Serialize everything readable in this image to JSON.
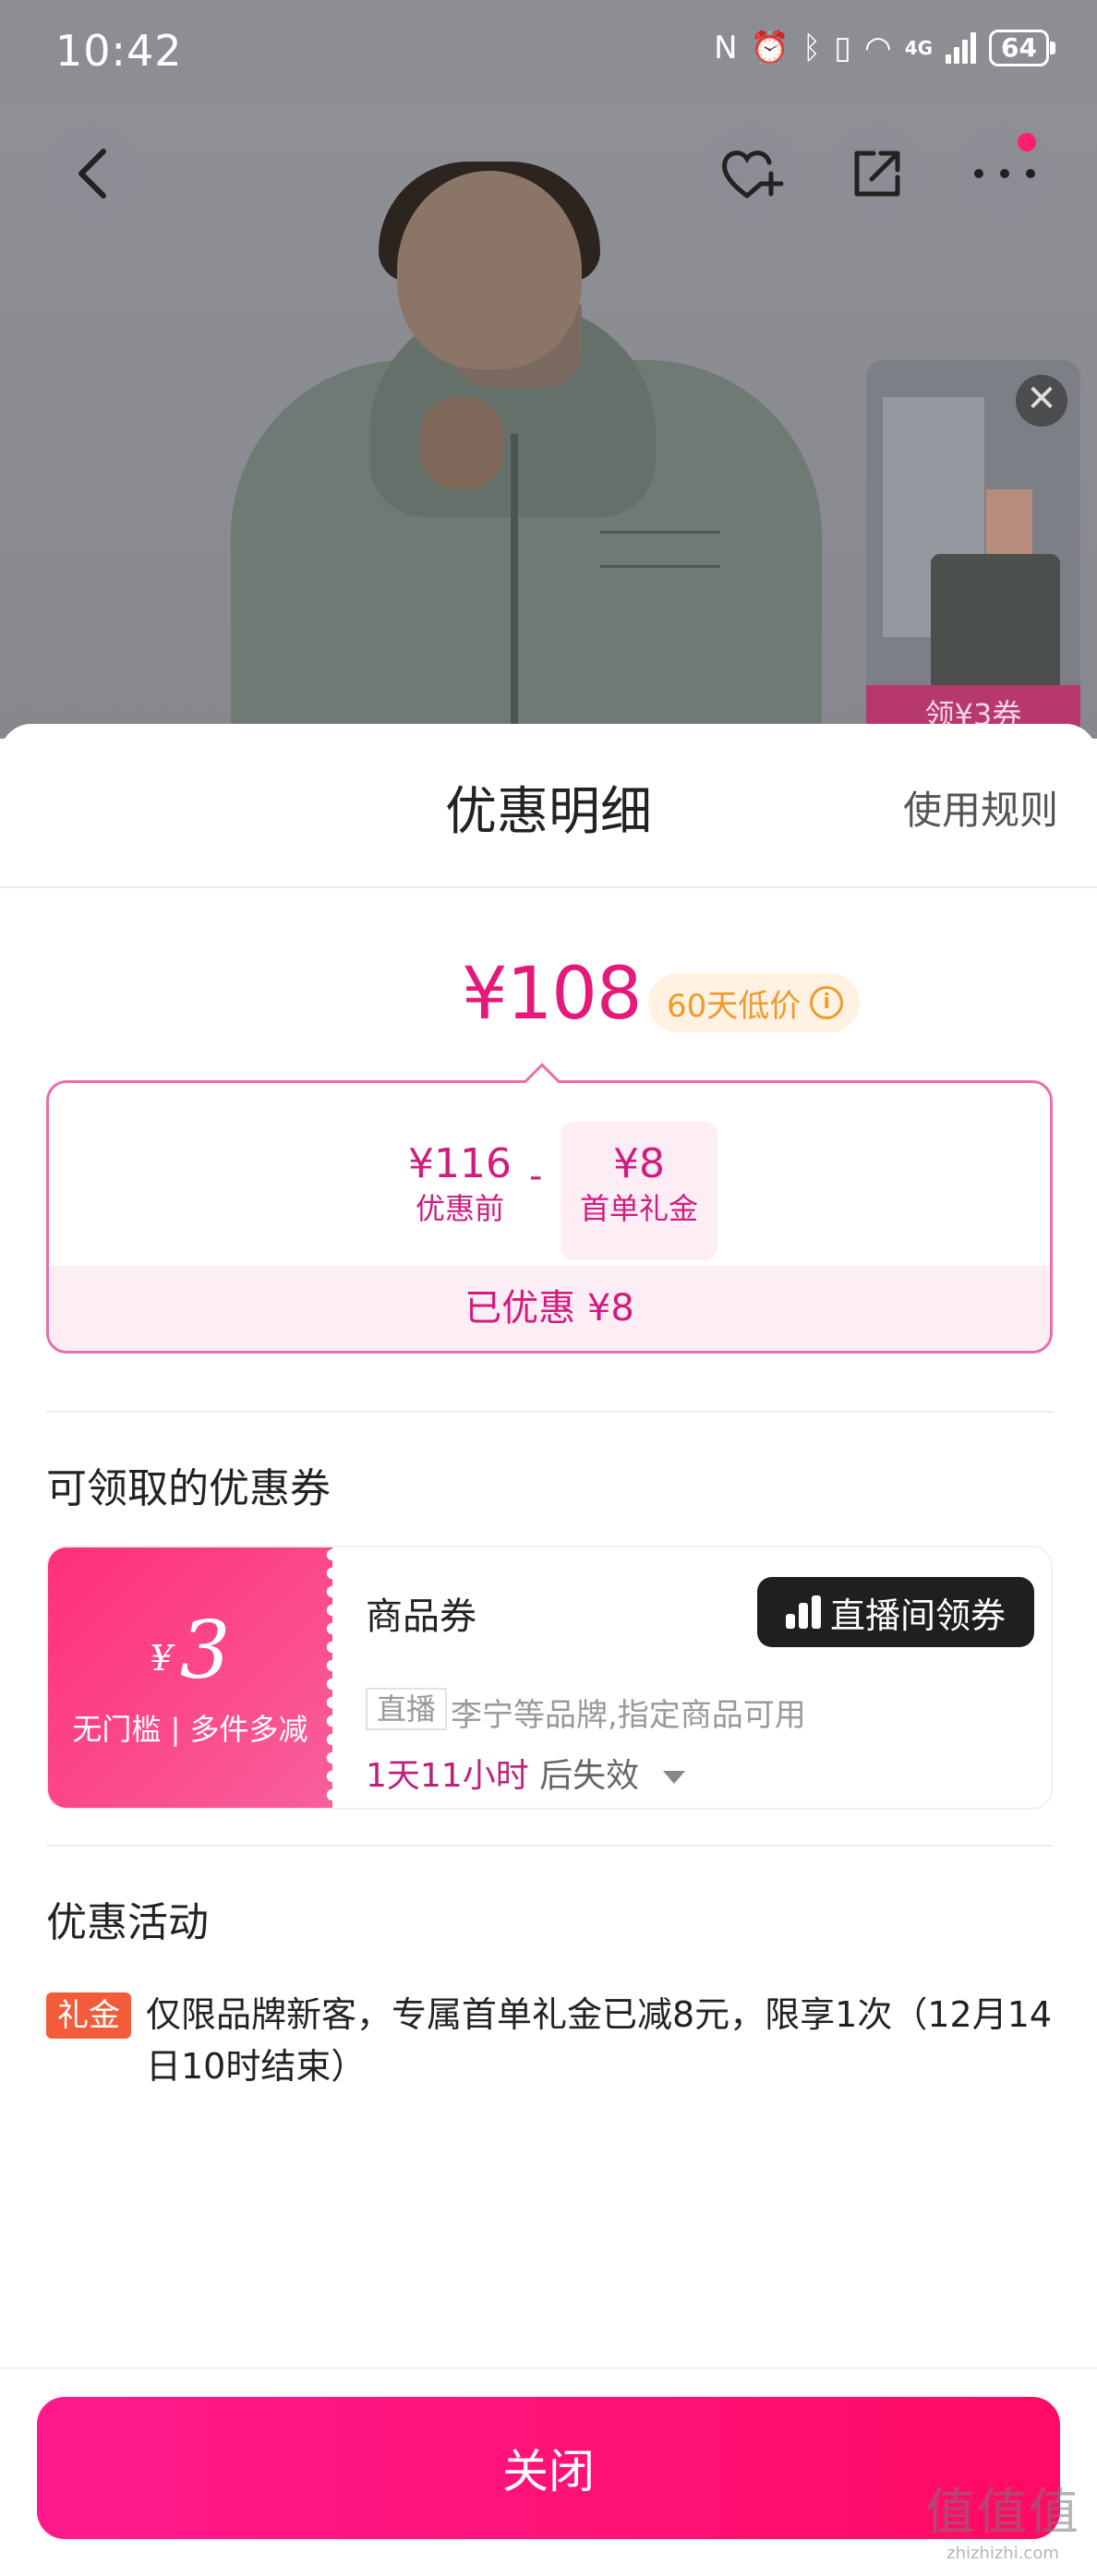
{
  "status_bar": {
    "time": "10:42",
    "network": "4G",
    "battery": "64"
  },
  "top_buttons": {
    "back_icon": "chevron-left-icon",
    "favorite_icon": "heart-plus-icon",
    "share_icon": "share-icon",
    "more_icon": "more-icon"
  },
  "floating_video": {
    "tag": "领¥3券",
    "close_glyph": "✕"
  },
  "sheet": {
    "title": "优惠明细",
    "rules_link": "使用规则"
  },
  "price": {
    "final": "¥108",
    "badge": "60天低价",
    "info_glyph": "i"
  },
  "calc": {
    "original_amount": "¥116",
    "original_label": "优惠前",
    "minus": "-",
    "gift_amount": "¥8",
    "gift_label": "首单礼金",
    "saved": "已优惠 ¥8"
  },
  "coupons_section": {
    "title": "可领取的优惠券"
  },
  "coupon": {
    "currency": "¥",
    "amount": "3",
    "condition": "无门槛 | 多件多减",
    "name": "商品券",
    "button_label": "直播间领券",
    "source_tag": "直播",
    "description": "李宁等品牌,指定商品可用",
    "expire_time": "1天11小时",
    "expire_suffix": "后失效"
  },
  "activities_section": {
    "title": "优惠活动"
  },
  "activity": {
    "tag": "礼金",
    "text": "仅限品牌新客，专属首单礼金已减8元，限享1次（12月14日10时结束）"
  },
  "footer": {
    "close_label": "关闭"
  },
  "watermark": {
    "line1": "值值值",
    "line2": "zhizhizhi.com"
  },
  "colors": {
    "accent": "#e6197a",
    "button_gradient_start": "#ff1a8c",
    "button_gradient_end": "#ff0a64",
    "low_price_badge": "#f09a2a",
    "activity_tag": "#f25c3a"
  }
}
